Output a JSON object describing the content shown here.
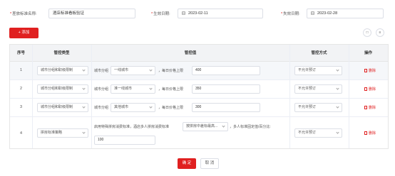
{
  "form": {
    "standard_name_label": "差旅标准名称:",
    "standard_name_value": "酒店标准看板验证",
    "effective_date_label": "生效日期:",
    "effective_date_value": "2023-02-11",
    "expire_date_label": "失效日期:",
    "expire_date_value": "2023-02-28",
    "required_mark": "*"
  },
  "toolbar": {
    "add_label": "+ 添加",
    "icon_a": "□",
    "icon_b": "≡"
  },
  "table": {
    "headers": {
      "seq": "序号",
      "control_type": "管控类型",
      "control_value": "管控值",
      "control_method": "管控方式",
      "actions": "操作"
    },
    "rows": [
      {
        "seq": "1",
        "control_type": "城市分组和职级限制",
        "city_group_label": "城市分组",
        "city_group_value": "一线城市",
        "price_limit_label": "每日价格上限",
        "price_limit_value": "400",
        "method": "不允许预订",
        "delete_label": "删除"
      },
      {
        "seq": "2",
        "control_type": "城市分组和职级限制",
        "city_group_label": "城市分组",
        "city_group_value": "准一线城市",
        "price_limit_label": "每日价格上限",
        "price_limit_value": "350",
        "method": "不允许预订",
        "delete_label": "删除"
      },
      {
        "seq": "3",
        "control_type": "城市分组和职级限制",
        "city_group_label": "城市分组",
        "city_group_value": "其他城市",
        "price_limit_label": "每日价格上限",
        "price_limit_value": "300",
        "method": "不允许预订",
        "delete_label": "删除"
      },
      {
        "seq": "4",
        "control_type": "拼房标准策略",
        "desc_prefix": "启用特殊拼房消费标准，酒店多人拼房消费标准",
        "policy_select": "按拼房中差标最高...",
        "desc_suffix": "，多人标准固定值/百分比:",
        "fixed_value": "100",
        "method": "不允许预订",
        "delete_label": "删除"
      }
    ]
  },
  "footer": {
    "confirm_label": "确 定",
    "cancel_label": "取 消"
  },
  "colors": {
    "brand_red": "#e02020",
    "header_bg": "#f2f3f5",
    "row_highlight": "#f5f7fa"
  }
}
